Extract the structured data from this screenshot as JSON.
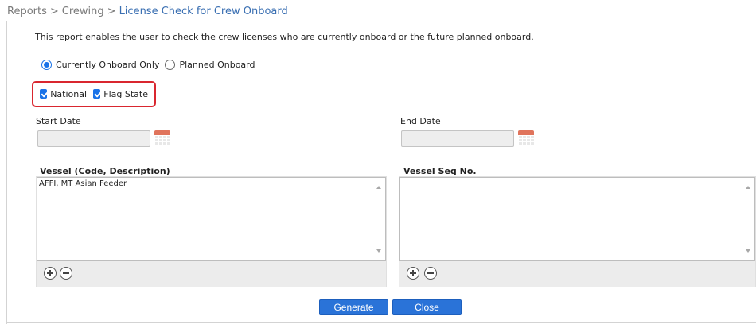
{
  "breadcrumb": {
    "items": [
      "Reports",
      "Crewing"
    ],
    "current": "License Check for Crew Onboard",
    "separator": ">"
  },
  "intro_text": "This report enables the user to check the crew licenses who are currently onboard or the future planned onboard.",
  "onboard_filter": {
    "options": [
      {
        "label": "Currently Onboard Only",
        "selected": true
      },
      {
        "label": "Planned Onboard",
        "selected": false
      }
    ]
  },
  "license_types": {
    "options": [
      {
        "label": "National",
        "checked": true
      },
      {
        "label": "Flag State",
        "checked": true
      }
    ]
  },
  "start_date": {
    "label": "Start Date",
    "value": ""
  },
  "end_date": {
    "label": "End Date",
    "value": ""
  },
  "vessel_list": {
    "title": "Vessel (Code, Description)",
    "items": [
      "AFFI, MT Asian Feeder"
    ]
  },
  "vessel_seq_list": {
    "title": "Vessel Seq No.",
    "items": []
  },
  "actions": {
    "generate_label": "Generate",
    "close_label": "Close"
  },
  "colors": {
    "accent": "#1a73e8",
    "button": "#2a73d8",
    "highlight_border": "#d9262f",
    "breadcrumb_current": "#3a6fb2"
  }
}
